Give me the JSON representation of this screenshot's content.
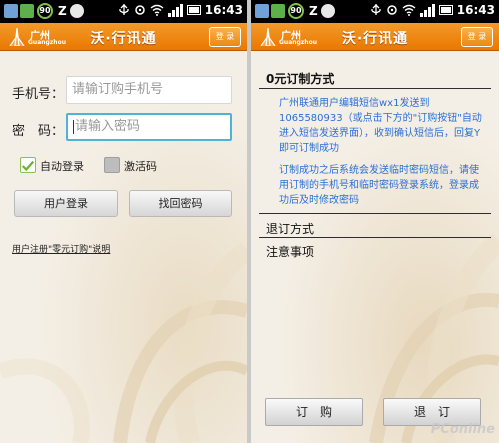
{
  "status_bar": {
    "badge": "90",
    "z": "Z",
    "time": "16:43"
  },
  "header": {
    "city": "广州",
    "city_pinyin": "Guangzhou",
    "title": "沃·行讯通",
    "login_label": "登 录"
  },
  "login_form": {
    "phone_label": "手机号：",
    "phone_placeholder": "请输订购手机号",
    "password_label": "密　码：",
    "password_placeholder": "请输入密码",
    "auto_login_label": "自动登录",
    "activation_label": "激活码",
    "login_button": "用户登录",
    "recover_button": "找回密码",
    "register_link": "用户注册\"零元订购\"说明"
  },
  "info_panel": {
    "subscribe_heading": "0元订制方式",
    "subscribe_text": "广州联通用户编辑短信wx1发送到1065580933（或点击下方的\"订购按钮\"自动进入短信发送界面），收到确认短信后，回复Y即可订制成功",
    "after_text": "订制成功之后系统会发送临时密码短信，请使用订制的手机号和临时密码登录系统，登录成功后及时修改密码",
    "unsubscribe_heading": "退订方式",
    "notes_heading": "注意事项",
    "subscribe_button": "订　购",
    "unsubscribe_button": "退　订",
    "watermark": "PConline"
  },
  "colors": {
    "accent": "#ef8a12",
    "link_blue": "#2a6fd6",
    "focus": "#4fb3d8"
  }
}
